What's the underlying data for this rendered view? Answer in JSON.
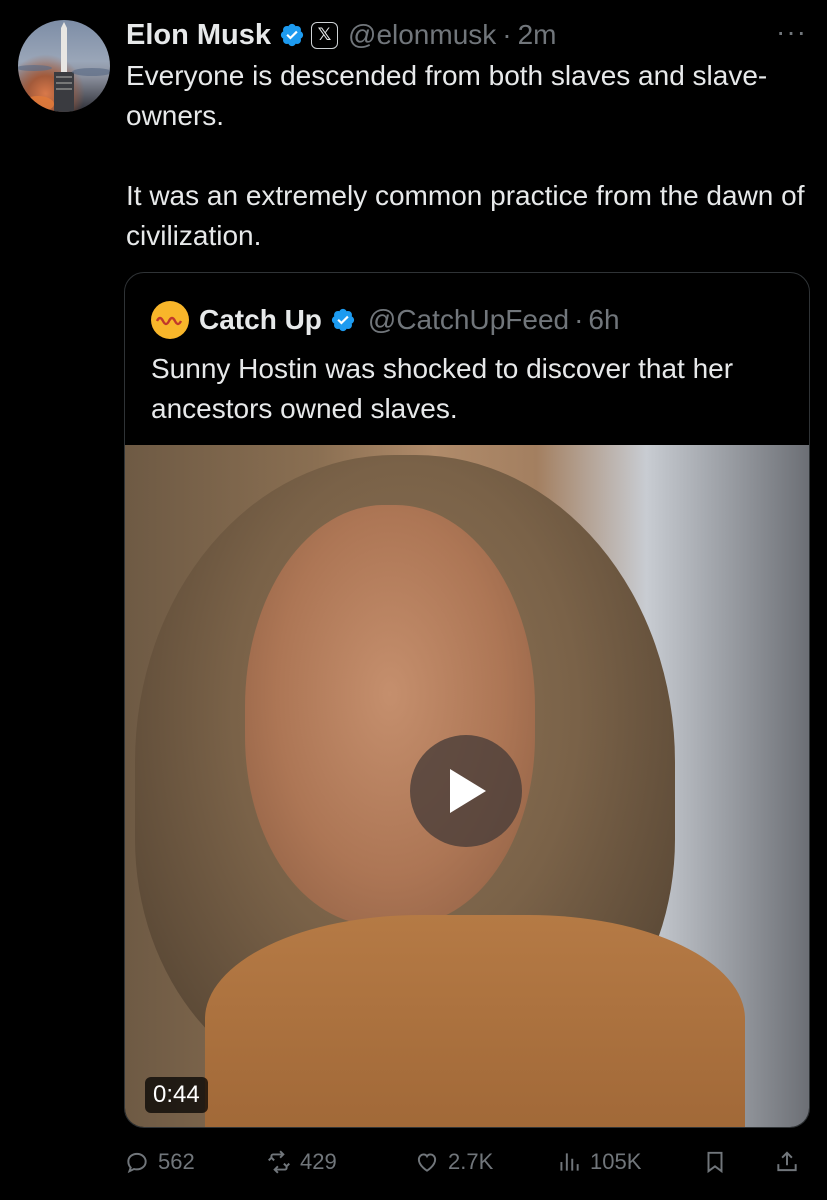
{
  "tweet": {
    "author_name": "Elon Musk",
    "handle": "@elonmusk",
    "separator": "·",
    "time": "2m",
    "more_label": "···",
    "x_badge": "𝕏",
    "text_line1": "Everyone is descended from both slaves and slave-owners.",
    "text_line2": "It was an extremely common practice from the dawn of civilization.",
    "avatar_icon": "starship-rocket-avatar",
    "verified_color": "#1d9bf0"
  },
  "quote": {
    "author_name": "Catch Up",
    "handle": "@CatchUpFeed",
    "separator": "·",
    "time": "6h",
    "text": "Sunny Hostin was shocked to discover that her ancestors owned slaves.",
    "logo_icon": "catch-up-logo",
    "logo_color": "#f8b62a",
    "video_duration": "0:44"
  },
  "actions": {
    "replies": "562",
    "reposts": "429",
    "likes": "2.7K",
    "views": "105K"
  }
}
